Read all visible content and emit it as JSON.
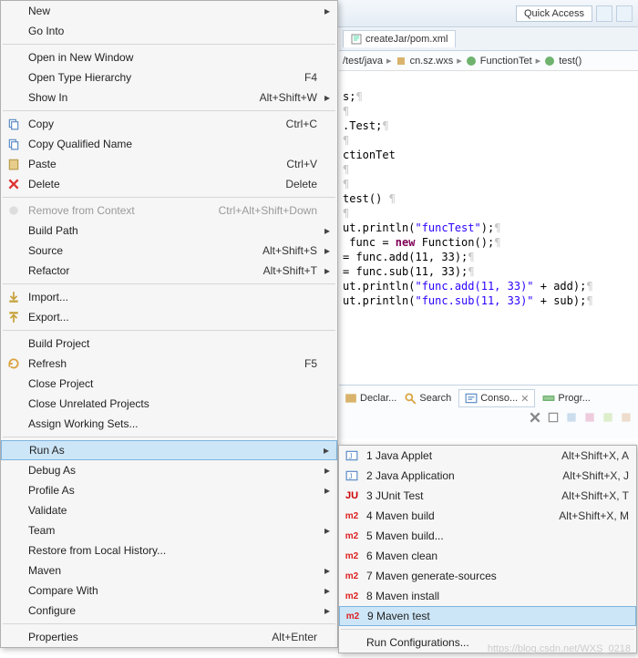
{
  "toolbar": {
    "quick_access": "Quick Access"
  },
  "editor": {
    "tab": "createJar/pom.xml"
  },
  "breadcrumb": {
    "path": "/test/java",
    "pkg": "cn.sz.wxs",
    "cls": "FunctionTet",
    "method": "test()"
  },
  "code": {
    "l1": "s;",
    "l2": ".Test;",
    "l3": "ctionTet",
    "l4": "test()",
    "l5a": "ut",
    "l5b": ".println(",
    "l5c": "\"funcTest\"",
    "l5d": ");",
    "l6a": " func = ",
    "l6b": "new",
    "l6c": " Function();",
    "l7a": "= func.add(11, 33);",
    "l8a": "= func.sub(11, 33);",
    "l9a": "ut",
    "l9b": ".println(",
    "l9c": "\"func.add(11, 33)\"",
    "l9d": " + add);",
    "l10a": "ut",
    "l10b": ".println(",
    "l10c": "\"func.sub(11, 33)\"",
    "l10d": " + sub);"
  },
  "bottom": {
    "declar": "Declar...",
    "search": "Search",
    "conso": "Conso...",
    "progr": "Progr..."
  },
  "menu": {
    "new": "New",
    "go_into": "Go Into",
    "open_new_window": "Open in New Window",
    "open_type_hierarchy": "Open Type Hierarchy",
    "open_type_hierarchy_sc": "F4",
    "show_in": "Show In",
    "show_in_sc": "Alt+Shift+W",
    "copy": "Copy",
    "copy_sc": "Ctrl+C",
    "copy_qualified": "Copy Qualified Name",
    "paste": "Paste",
    "paste_sc": "Ctrl+V",
    "delete": "Delete",
    "delete_sc": "Delete",
    "remove_context": "Remove from Context",
    "remove_context_sc": "Ctrl+Alt+Shift+Down",
    "build_path": "Build Path",
    "source": "Source",
    "source_sc": "Alt+Shift+S",
    "refactor": "Refactor",
    "refactor_sc": "Alt+Shift+T",
    "import": "Import...",
    "export": "Export...",
    "build_project": "Build Project",
    "refresh": "Refresh",
    "refresh_sc": "F5",
    "close_project": "Close Project",
    "close_unrelated": "Close Unrelated Projects",
    "assign_ws": "Assign Working Sets...",
    "run_as": "Run As",
    "debug_as": "Debug As",
    "profile_as": "Profile As",
    "validate": "Validate",
    "team": "Team",
    "restore_history": "Restore from Local History...",
    "maven": "Maven",
    "compare_with": "Compare With",
    "configure": "Configure",
    "properties": "Properties",
    "properties_sc": "Alt+Enter"
  },
  "submenu": {
    "items": [
      {
        "ico": "java",
        "n": "1",
        "label": "Java Applet",
        "sc": "Alt+Shift+X, A"
      },
      {
        "ico": "java",
        "n": "2",
        "label": "Java Application",
        "sc": "Alt+Shift+X, J"
      },
      {
        "ico": "ju",
        "n": "3",
        "label": "JUnit Test",
        "sc": "Alt+Shift+X, T"
      },
      {
        "ico": "m2",
        "n": "4",
        "label": "Maven build",
        "sc": "Alt+Shift+X, M"
      },
      {
        "ico": "m2",
        "n": "5",
        "label": "Maven build...",
        "sc": ""
      },
      {
        "ico": "m2",
        "n": "6",
        "label": "Maven clean",
        "sc": ""
      },
      {
        "ico": "m2",
        "n": "7",
        "label": "Maven generate-sources",
        "sc": ""
      },
      {
        "ico": "m2",
        "n": "8",
        "label": "Maven install",
        "sc": ""
      },
      {
        "ico": "m2",
        "n": "9",
        "label": "Maven test",
        "sc": ""
      }
    ],
    "run_config": "Run Configurations..."
  },
  "watermark": "https://blog.csdn.net/WXS_0218"
}
